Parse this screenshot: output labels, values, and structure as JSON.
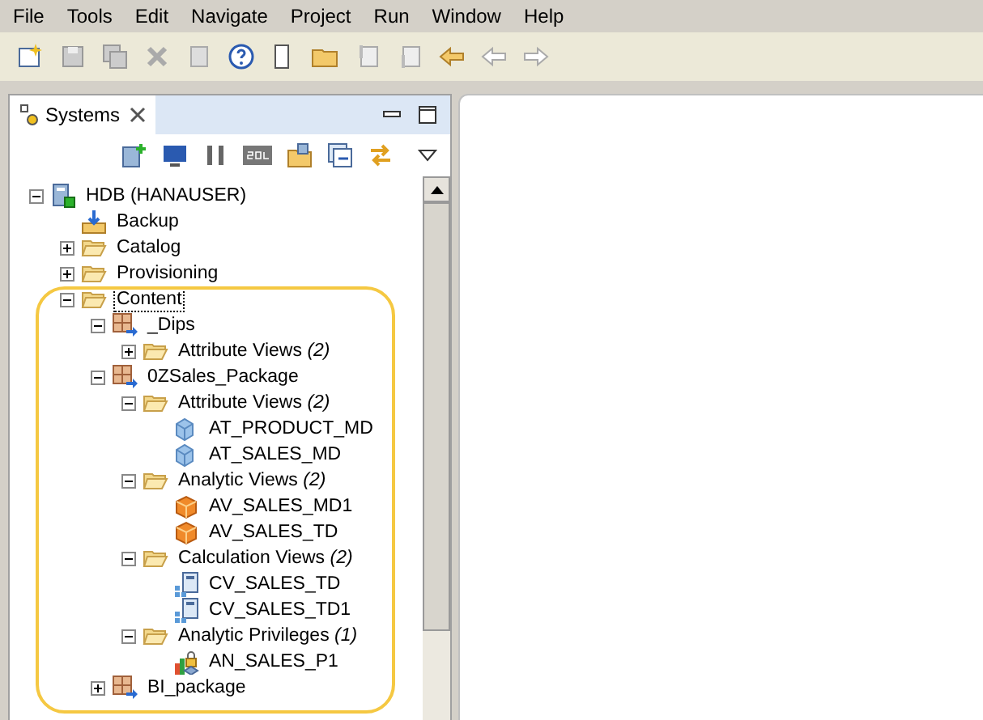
{
  "menu": [
    "File",
    "Tools",
    "Edit",
    "Navigate",
    "Project",
    "Run",
    "Window",
    "Help"
  ],
  "view": {
    "tab": {
      "label": "Systems",
      "selected": true
    }
  },
  "tree": [
    {
      "label": "HDB (HANAUSER)",
      "kind": "system",
      "expanded": true,
      "selected": false,
      "children": [
        {
          "label": "Backup",
          "kind": "backup",
          "selected": false
        },
        {
          "label": "Catalog",
          "kind": "folder",
          "expanded": false,
          "selected": false
        },
        {
          "label": "Provisioning",
          "kind": "folder",
          "expanded": false,
          "selected": false
        },
        {
          "label": "Content",
          "kind": "folder",
          "expanded": true,
          "selected": true,
          "children": [
            {
              "label": "_Dips",
              "kind": "package",
              "expanded": true,
              "selected": false,
              "children": [
                {
                  "label": "Attribute Views *(2)*",
                  "kind": "folder",
                  "expanded": false,
                  "selected": false
                }
              ]
            },
            {
              "label": "0ZSales_Package",
              "kind": "package",
              "expanded": true,
              "selected": false,
              "children": [
                {
                  "label": "Attribute Views *(2)*",
                  "kind": "folder",
                  "expanded": true,
                  "selected": false,
                  "children": [
                    {
                      "label": "AT_PRODUCT_MD",
                      "kind": "attribute-view",
                      "selected": false
                    },
                    {
                      "label": "AT_SALES_MD",
                      "kind": "attribute-view",
                      "selected": false
                    }
                  ]
                },
                {
                  "label": "Analytic Views *(2)*",
                  "kind": "folder",
                  "expanded": true,
                  "selected": false,
                  "children": [
                    {
                      "label": "AV_SALES_MD1",
                      "kind": "analytic-view",
                      "selected": false
                    },
                    {
                      "label": "AV_SALES_TD",
                      "kind": "analytic-view",
                      "selected": false
                    }
                  ]
                },
                {
                  "label": "Calculation Views *(2)*",
                  "kind": "folder",
                  "expanded": true,
                  "selected": false,
                  "children": [
                    {
                      "label": "CV_SALES_TD",
                      "kind": "calculation-view",
                      "selected": false
                    },
                    {
                      "label": "CV_SALES_TD1",
                      "kind": "calculation-view",
                      "selected": false
                    }
                  ]
                },
                {
                  "label": "Analytic Privileges *(1)*",
                  "kind": "folder",
                  "expanded": true,
                  "selected": false,
                  "children": [
                    {
                      "label": "AN_SALES_P1",
                      "kind": "privilege",
                      "selected": false
                    }
                  ]
                }
              ]
            },
            {
              "label": "BI_package",
              "kind": "package",
              "expanded": false,
              "selected": false
            }
          ]
        }
      ]
    }
  ]
}
